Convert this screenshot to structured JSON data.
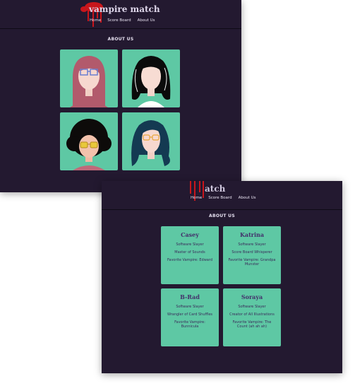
{
  "app": {
    "logo_text": "vampire match"
  },
  "nav": {
    "home": "Home",
    "score_board": "Score Board",
    "about_us": "About Us"
  },
  "page": {
    "title": "ABOUT US"
  },
  "team": [
    {
      "name": "Casey",
      "lines": [
        "Software Slayer",
        "Master of Sounds",
        "Favorite Vampire: Edward"
      ]
    },
    {
      "name": "Katrina",
      "lines": [
        "Software Slayer",
        "Score Board Whisperer",
        "Favorite Vampire: Grandpa Munster"
      ]
    },
    {
      "name": "B-Rad",
      "lines": [
        "Software Slayer",
        "Wrangler of Card Shuffles",
        "Favorite Vampire: Bunnicula"
      ]
    },
    {
      "name": "Soraya",
      "lines": [
        "Software Slayer",
        "Creator of All Illustrations",
        "Favorite Vampire: The Count (ah ah ah)"
      ]
    }
  ],
  "colors": {
    "background": "#231930",
    "tile": "#5ec8a4",
    "blood": "#c8161c",
    "name": "#43306b"
  },
  "icons": [
    "blood-splatter-icon"
  ]
}
